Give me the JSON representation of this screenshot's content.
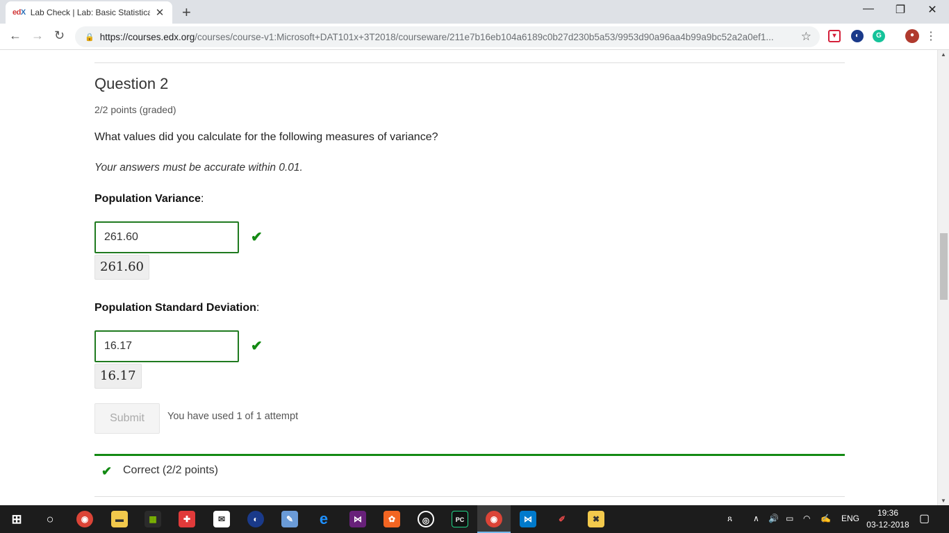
{
  "browser": {
    "tab": {
      "favicon_prefix": "ed",
      "favicon_suffix": "X",
      "title": "Lab Check | Lab: Basic Statistical",
      "close": "✕"
    },
    "new_tab": "+",
    "window": {
      "minimize": "—",
      "maximize": "❐",
      "close": "✕"
    },
    "nav": {
      "back": "←",
      "forward": "→",
      "reload": "↻"
    },
    "url_host": "https://courses.edx.org",
    "url_path": "/courses/course-v1:Microsoft+DAT101x+3T2018/courseware/211e7b16eb104a6189c0b27d230b5a53/9953d90a96aa4b99a9bc52a2a0ef1...",
    "star": "☆",
    "menu": "⋮"
  },
  "question": {
    "title": "Question 2",
    "points": "2/2 points (graded)",
    "prompt": "What values did you calculate for the following measures of variance?",
    "note": "Your answers must be accurate within 0.01.",
    "fields": [
      {
        "label": "Population Variance",
        "value": "261.60",
        "preview": "261.60"
      },
      {
        "label": "Population Standard Deviation",
        "value": "16.17",
        "preview": "16.17"
      }
    ],
    "colon": ":",
    "check_mark": "✔",
    "submit_label": "Submit",
    "attempts": "You have used 1 of 1 attempt",
    "result": "Correct (2/2 points)"
  },
  "scrollbar": {
    "up": "▲",
    "down": "▼",
    "position": 0.47
  },
  "taskbar": {
    "tray_language": "ENG",
    "time": "19:36",
    "date": "03-12-2018"
  },
  "colors": {
    "accent_green": "#138a13",
    "input_border": "#1f7a1f",
    "taskbar": "#1c1c1c"
  }
}
